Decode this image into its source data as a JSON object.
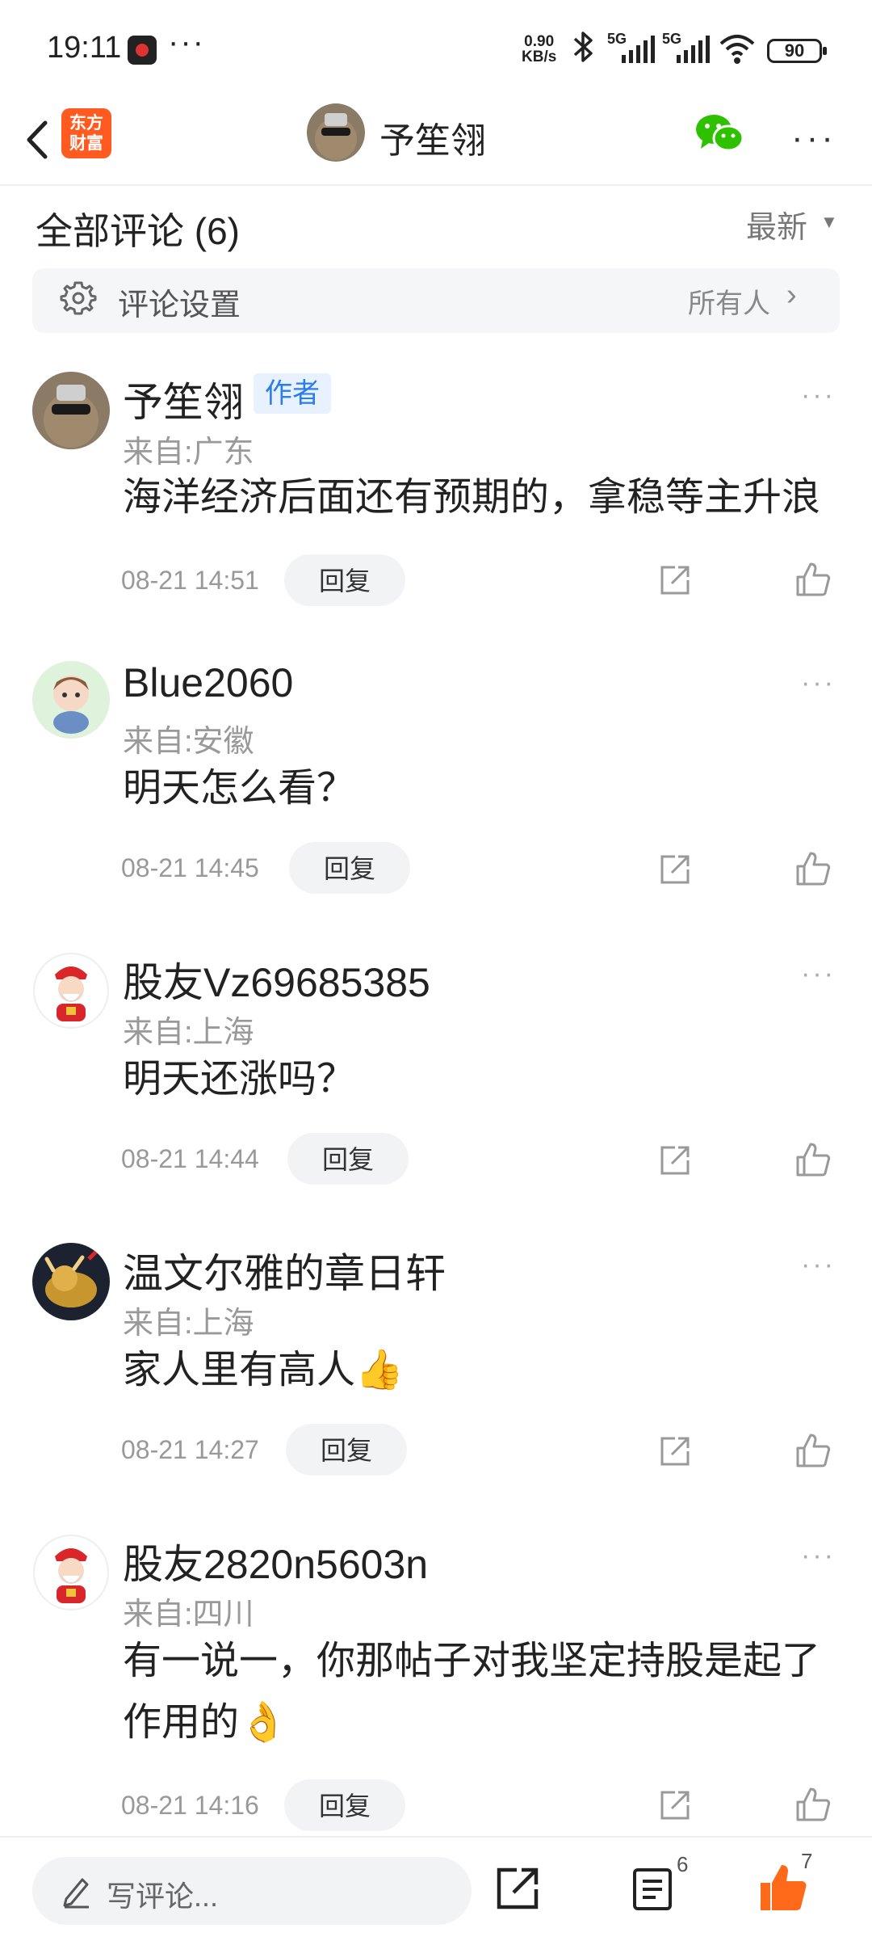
{
  "status_bar": {
    "time": "19:11",
    "dots": "···",
    "net_speed_value": "0.90",
    "net_speed_unit": "KB/s",
    "signal1_label": "5G",
    "signal2_label": "5G",
    "battery": "90"
  },
  "nav": {
    "logo_line1": "东方",
    "logo_line2": "财富",
    "title": "予笙翎",
    "colors": {
      "logo": "#ff5a1f",
      "wechat": "#2dc100"
    }
  },
  "comments_header": {
    "title": "全部评论 (6)",
    "sort": "最新"
  },
  "settings": {
    "label": "评论设置",
    "value": "所有人"
  },
  "comments": [
    {
      "name": "予笙翎",
      "badge": "作者",
      "location": "来自:广东",
      "text": "海洋经济后面还有预期的，拿稳等主升浪",
      "time": "08-21 14:51",
      "reply": "回复"
    },
    {
      "name": "Blue2060",
      "location": "来自:安徽",
      "text": "明天怎么看？",
      "time": "08-21 14:45",
      "reply": "回复"
    },
    {
      "name": "股友Vz69685385",
      "location": "来自:上海",
      "text": "明天还涨吗？",
      "time": "08-21 14:44",
      "reply": "回复"
    },
    {
      "name": "温文尔雅的章日轩",
      "location": "来自:上海",
      "text": "家人里有高人👍",
      "time": "08-21 14:27",
      "reply": "回复"
    },
    {
      "name": "股友2820n5603n",
      "location": "来自:四川",
      "text": "有一说一，你那帖子对我坚定持股是起了作用的👌",
      "time": "08-21 14:16",
      "reply": "回复"
    }
  ],
  "bottom_bar": {
    "placeholder": "写评论...",
    "list_count": "6",
    "like_count": "7",
    "accent": "#ff6a1a"
  }
}
